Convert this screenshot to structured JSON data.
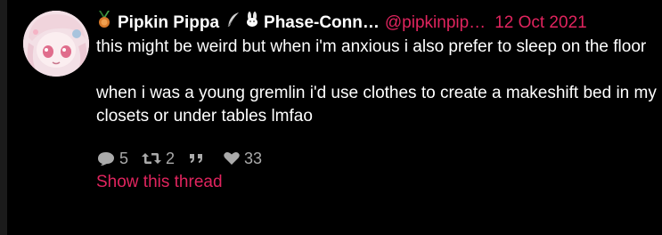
{
  "tweet": {
    "name": "Pipkin Pippa",
    "display_suffix": "Phase-Conn…",
    "handle": "@pipkinpip…",
    "date": "12 Oct 2021",
    "paragraphs": [
      "this might be weird but when i'm anxious i also prefer to sleep on the floor",
      "when i was a young gremlin i'd use clothes to create a makeshift bed in my closets or under tables lmfao"
    ],
    "stats": {
      "replies": "5",
      "retweets": "2",
      "likes": "33"
    },
    "show_thread_label": "Show this thread"
  },
  "colors": {
    "accent": "#e0245e",
    "background": "#000000",
    "text": "#ffffff",
    "muted": "#aaaaaa"
  },
  "icons": [
    "medal-icon",
    "feather-icon",
    "bunny-icon",
    "reply-icon",
    "retweet-icon",
    "quote-icon",
    "heart-icon"
  ]
}
